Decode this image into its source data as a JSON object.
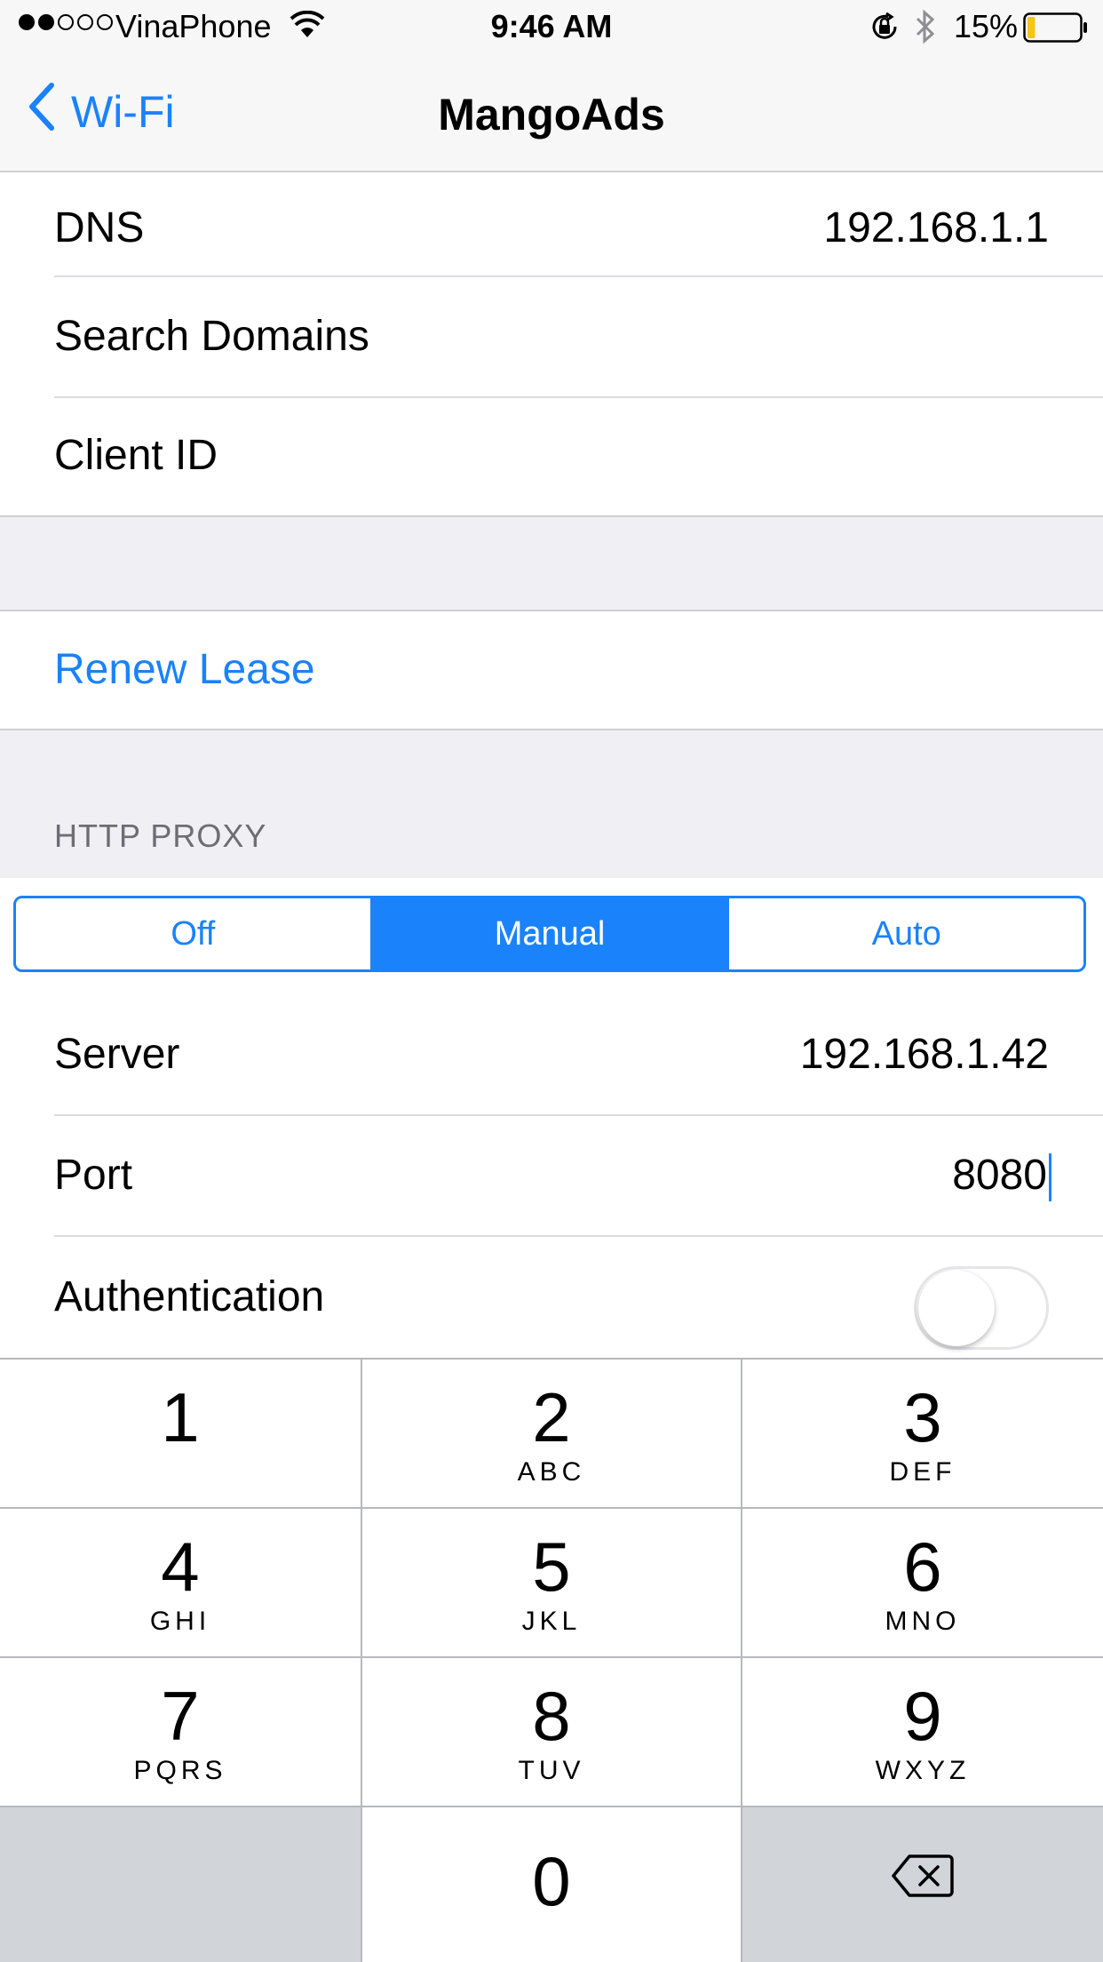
{
  "status_bar": {
    "carrier": "VinaPhone",
    "time": "9:46 AM",
    "battery_percent": "15%",
    "signal_strength": 2,
    "signal_max": 5,
    "battery_level": 0.15
  },
  "nav": {
    "back_label": "Wi-Fi",
    "title": "MangoAds"
  },
  "ip_section": {
    "rows": [
      {
        "label": "DNS",
        "value": "192.168.1.1"
      },
      {
        "label": "Search Domains",
        "value": ""
      },
      {
        "label": "Client ID",
        "value": ""
      }
    ]
  },
  "renew_lease": "Renew Lease",
  "proxy": {
    "header": "HTTP PROXY",
    "segments": [
      "Off",
      "Manual",
      "Auto"
    ],
    "selected": "Manual",
    "server_label": "Server",
    "server_value": "192.168.1.42",
    "port_label": "Port",
    "port_value": "8080",
    "auth_label": "Authentication",
    "auth_enabled": false
  },
  "keypad": {
    "keys": [
      {
        "num": "1",
        "letters": ""
      },
      {
        "num": "2",
        "letters": "ABC"
      },
      {
        "num": "3",
        "letters": "DEF"
      },
      {
        "num": "4",
        "letters": "GHI"
      },
      {
        "num": "5",
        "letters": "JKL"
      },
      {
        "num": "6",
        "letters": "MNO"
      },
      {
        "num": "7",
        "letters": "PQRS"
      },
      {
        "num": "8",
        "letters": "TUV"
      },
      {
        "num": "9",
        "letters": "WXYZ"
      },
      {
        "num": "0",
        "letters": ""
      }
    ]
  },
  "colors": {
    "accent": "#1a82fb",
    "background": "#efeff4",
    "battery_fill": "#f5c518"
  }
}
